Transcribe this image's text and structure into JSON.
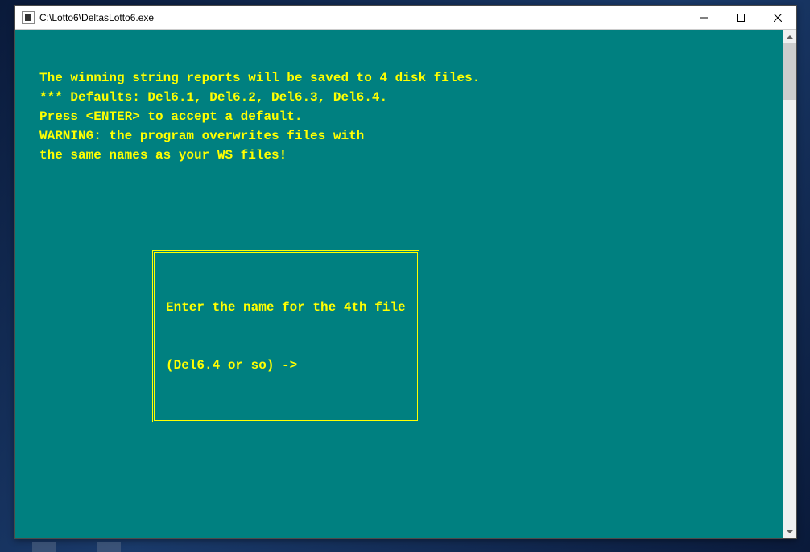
{
  "window": {
    "title": "C:\\Lotto6\\DeltasLotto6.exe"
  },
  "console": {
    "lines": [
      "The winning string reports will be saved to 4 disk files.",
      "*** Defaults: Del6.1, Del6.2, Del6.3, Del6.4.",
      "Press <ENTER> to accept a default.",
      "WARNING: the program overwrites files with",
      "the same names as your WS files!"
    ],
    "prompt": {
      "line1": "Enter the name for the 4th file",
      "line2": "(Del6.4 or so) ->"
    }
  },
  "colors": {
    "console_bg": "#008080",
    "console_fg": "#ffff00"
  }
}
